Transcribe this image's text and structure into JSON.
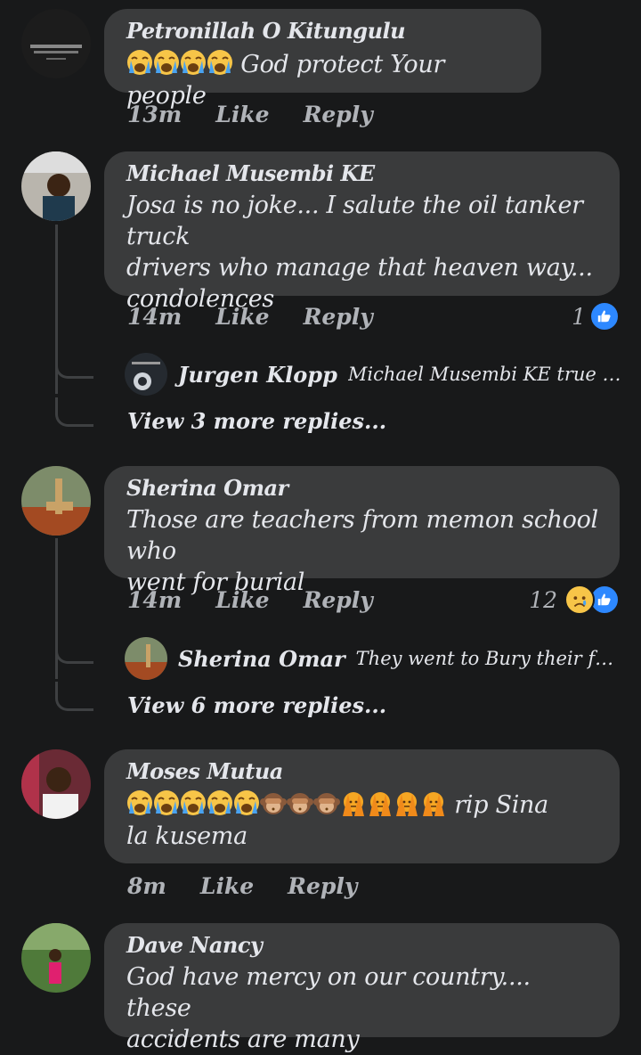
{
  "comments": [
    {
      "author": "Petronillah O Kitungulu",
      "text": "God protect Your people",
      "emoji_prefix": "crying-face x4",
      "time": "13m",
      "like": "Like",
      "reply": "Reply"
    },
    {
      "author": "Michael Musembi KE",
      "lines": [
        "Josa is no joke... I salute the oil tanker truck",
        "drivers who manage that heaven way...",
        "condolences"
      ],
      "time": "14m",
      "like": "Like",
      "reply": "Reply",
      "reaction_count": "1",
      "reply_preview": {
        "author": "Jurgen Klopp",
        "text": "Michael Musembi KE true bro tha..."
      },
      "more_replies": "View 3 more replies..."
    },
    {
      "author": "Sherina Omar",
      "lines": [
        "Those are teachers from memon school who",
        "went for burial"
      ],
      "time": "14m",
      "like": "Like",
      "reply": "Reply",
      "reaction_count": "12",
      "reply_preview": {
        "author": "Sherina Omar",
        "text": "They went to Bury their fellow t..."
      },
      "more_replies": "View 6 more replies..."
    },
    {
      "author": "Moses Mutua",
      "emoji_line": "crying x5, see-no-evil monkey x3, person gesturing no x4",
      "line1_text": "rip Sina",
      "line2": "la kusema",
      "time": "8m",
      "like": "Like",
      "reply": "Reply"
    },
    {
      "author": "Dave Nancy",
      "lines": [
        "God have mercy on our country.... these",
        "accidents are many"
      ]
    }
  ],
  "colors": {
    "background": "#18191a",
    "bubble": "#3a3b3c",
    "secondary_text": "#b0b3b8",
    "like_blue": "#2d88ff"
  }
}
